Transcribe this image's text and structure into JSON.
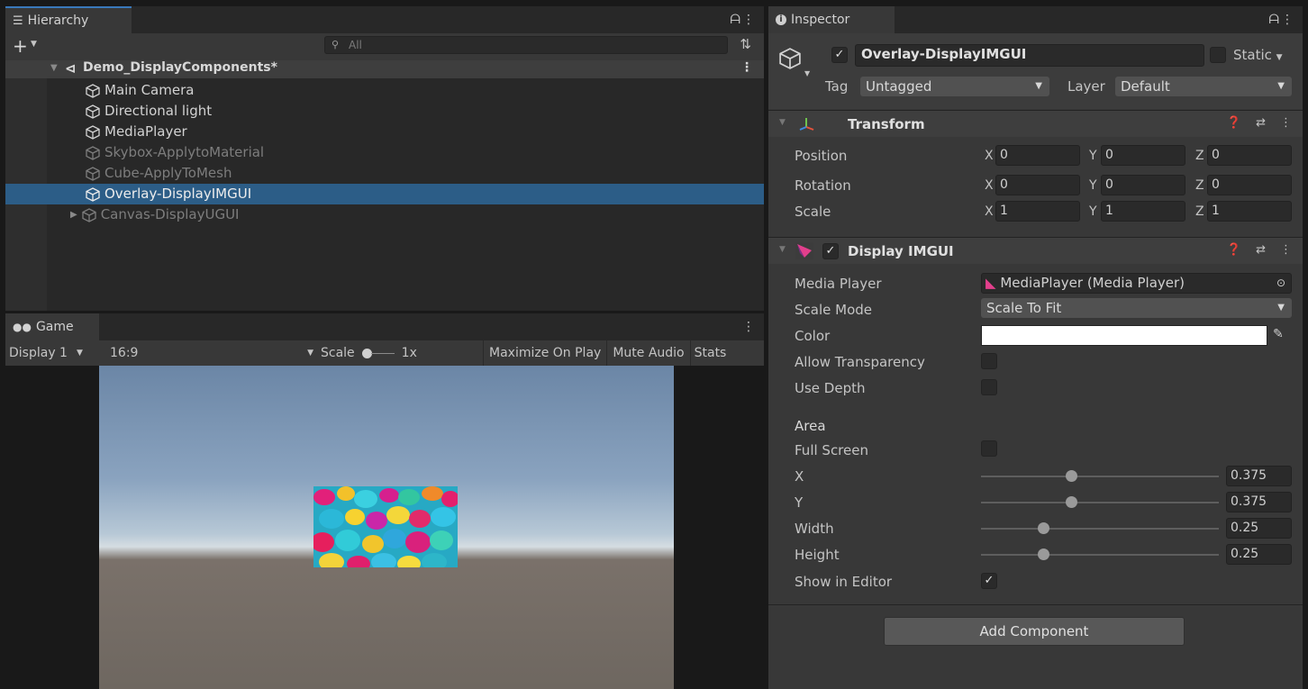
{
  "hierarchy": {
    "tab_label": "Hierarchy",
    "search_placeholder": "All",
    "scene_name": "Demo_DisplayComponents*",
    "items": [
      {
        "label": "Main Camera"
      },
      {
        "label": "Directional light"
      },
      {
        "label": "MediaPlayer"
      },
      {
        "label": "Skybox-ApplytoMaterial"
      },
      {
        "label": "Cube-ApplyToMesh"
      },
      {
        "label": "Overlay-DisplayIMGUI"
      },
      {
        "label": "Canvas-DisplayUGUI"
      }
    ]
  },
  "game": {
    "tab_label": "Game",
    "display": "Display 1",
    "aspect": "16:9",
    "scale_label": "Scale",
    "scale_value": "1x",
    "maximize_on_play": "Maximize On Play",
    "mute_audio": "Mute Audio",
    "stats": "Stats"
  },
  "inspector": {
    "tab_label": "Inspector",
    "object_name": "Overlay-DisplayIMGUI",
    "static_label": "Static",
    "tag_label": "Tag",
    "tag_value": "Untagged",
    "layer_label": "Layer",
    "layer_value": "Default",
    "transform": {
      "title": "Transform",
      "position_label": "Position",
      "rotation_label": "Rotation",
      "scale_label": "Scale",
      "x_label": "X",
      "y_label": "Y",
      "z_label": "Z",
      "position": {
        "x": "0",
        "y": "0",
        "z": "0"
      },
      "rotation": {
        "x": "0",
        "y": "0",
        "z": "0"
      },
      "scale": {
        "x": "1",
        "y": "1",
        "z": "1"
      }
    },
    "display_imgui": {
      "title": "Display IMGUI",
      "media_player_label": "Media Player",
      "media_player_value": "MediaPlayer (Media Player)",
      "scale_mode_label": "Scale Mode",
      "scale_mode_value": "Scale To Fit",
      "color_label": "Color",
      "color_value": "#ffffff",
      "allow_transparency_label": "Allow Transparency",
      "use_depth_label": "Use Depth",
      "area_label": "Area",
      "full_screen_label": "Full Screen",
      "x_label": "X",
      "x_value": "0.375",
      "y_label": "Y",
      "y_value": "0.375",
      "width_label": "Width",
      "width_value": "0.25",
      "height_label": "Height",
      "height_value": "0.25",
      "show_in_editor_label": "Show in Editor"
    },
    "add_component": "Add Component"
  }
}
